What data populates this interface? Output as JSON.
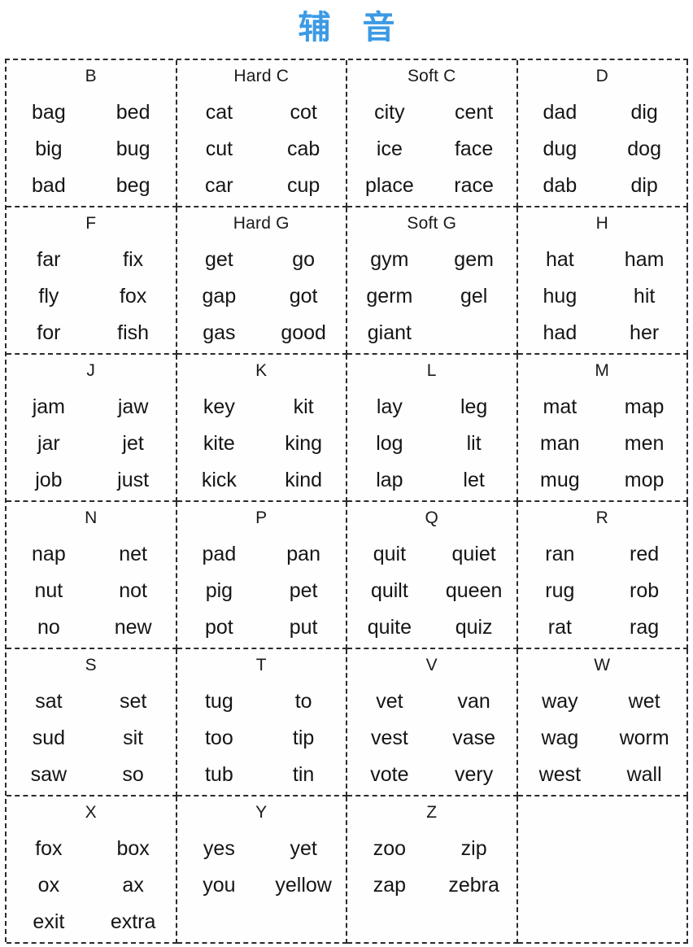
{
  "page": {
    "title": "辅 音",
    "title_color": "#3c9ae5",
    "text_color": "#151515",
    "border_color": "#2b2b2b",
    "background": "#ffffff"
  },
  "table": {
    "columns": 4,
    "rows": 7,
    "cells": [
      {
        "heading": "B",
        "words": [
          [
            "bag",
            "bed"
          ],
          [
            "big",
            "bug"
          ],
          [
            "bad",
            "beg"
          ]
        ]
      },
      {
        "heading": "Hard C",
        "words": [
          [
            "cat",
            "cot"
          ],
          [
            "cut",
            "cab"
          ],
          [
            "car",
            "cup"
          ]
        ]
      },
      {
        "heading": "Soft C",
        "words": [
          [
            "city",
            "cent"
          ],
          [
            "ice",
            "face"
          ],
          [
            "place",
            "race"
          ]
        ]
      },
      {
        "heading": "D",
        "words": [
          [
            "dad",
            "dig"
          ],
          [
            "dug",
            "dog"
          ],
          [
            "dab",
            "dip"
          ]
        ]
      },
      {
        "heading": "F",
        "words": [
          [
            "far",
            "fix"
          ],
          [
            "fly",
            "fox"
          ],
          [
            "for",
            "fish"
          ]
        ]
      },
      {
        "heading": "Hard G",
        "words": [
          [
            "get",
            "go"
          ],
          [
            "gap",
            "got"
          ],
          [
            "gas",
            "good"
          ]
        ]
      },
      {
        "heading": "Soft G",
        "words": [
          [
            "gym",
            "gem"
          ],
          [
            "germ",
            "gel"
          ],
          [
            "giant",
            ""
          ]
        ]
      },
      {
        "heading": "H",
        "words": [
          [
            "hat",
            "ham"
          ],
          [
            "hug",
            "hit"
          ],
          [
            "had",
            "her"
          ]
        ]
      },
      {
        "heading": "J",
        "words": [
          [
            "jam",
            "jaw"
          ],
          [
            "jar",
            "jet"
          ],
          [
            "job",
            "just"
          ]
        ]
      },
      {
        "heading": "K",
        "words": [
          [
            "key",
            "kit"
          ],
          [
            "kite",
            "king"
          ],
          [
            "kick",
            "kind"
          ]
        ]
      },
      {
        "heading": "L",
        "words": [
          [
            "lay",
            "leg"
          ],
          [
            "log",
            "lit"
          ],
          [
            "lap",
            "let"
          ]
        ]
      },
      {
        "heading": "M",
        "words": [
          [
            "mat",
            "map"
          ],
          [
            "man",
            "men"
          ],
          [
            "mug",
            "mop"
          ]
        ]
      },
      {
        "heading": "N",
        "words": [
          [
            "nap",
            "net"
          ],
          [
            "nut",
            "not"
          ],
          [
            "no",
            "new"
          ]
        ]
      },
      {
        "heading": "P",
        "words": [
          [
            "pad",
            "pan"
          ],
          [
            "pig",
            "pet"
          ],
          [
            "pot",
            "put"
          ]
        ]
      },
      {
        "heading": "Q",
        "words": [
          [
            "quit",
            "quiet"
          ],
          [
            "quilt",
            "queen"
          ],
          [
            "quite",
            "quiz"
          ]
        ]
      },
      {
        "heading": "R",
        "words": [
          [
            "ran",
            "red"
          ],
          [
            "rug",
            "rob"
          ],
          [
            "rat",
            "rag"
          ]
        ]
      },
      {
        "heading": "S",
        "words": [
          [
            "sat",
            "set"
          ],
          [
            "sud",
            "sit"
          ],
          [
            "saw",
            "so"
          ]
        ]
      },
      {
        "heading": "T",
        "words": [
          [
            "tug",
            "to"
          ],
          [
            "too",
            "tip"
          ],
          [
            "tub",
            "tin"
          ]
        ]
      },
      {
        "heading": "V",
        "words": [
          [
            "vet",
            "van"
          ],
          [
            "vest",
            "vase"
          ],
          [
            "vote",
            "very"
          ]
        ]
      },
      {
        "heading": "W",
        "words": [
          [
            "way",
            "wet"
          ],
          [
            "wag",
            "worm"
          ],
          [
            "west",
            "wall"
          ]
        ]
      },
      {
        "heading": "X",
        "words": [
          [
            "fox",
            "box"
          ],
          [
            "ox",
            "ax"
          ],
          [
            "exit",
            "extra"
          ]
        ]
      },
      {
        "heading": "Y",
        "words": [
          [
            "yes",
            "yet"
          ],
          [
            "you",
            "yellow"
          ],
          [
            "",
            ""
          ]
        ]
      },
      {
        "heading": "Z",
        "words": [
          [
            "zoo",
            "zip"
          ],
          [
            "zap",
            "zebra"
          ],
          [
            "",
            ""
          ]
        ]
      },
      {
        "heading": "",
        "words": [
          [
            "",
            ""
          ],
          [
            "",
            ""
          ],
          [
            "",
            ""
          ]
        ]
      }
    ]
  }
}
